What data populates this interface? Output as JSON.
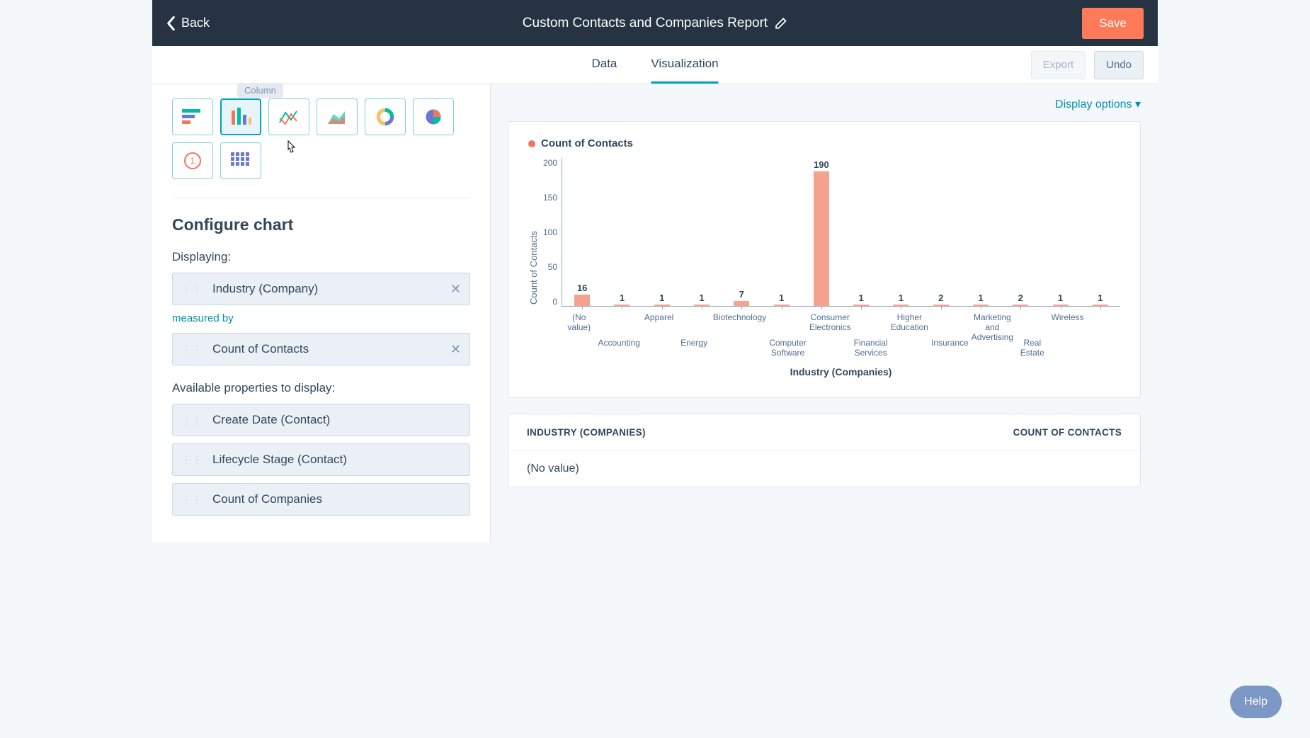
{
  "header": {
    "back_label": "Back",
    "title": "Custom Contacts and Companies Report",
    "save_label": "Save"
  },
  "tabs": {
    "data": "Data",
    "visualization": "Visualization",
    "export": "Export",
    "undo": "Undo"
  },
  "chart_types": {
    "tooltip": "Column",
    "items": [
      "bar-horizontal",
      "bar-vertical",
      "line",
      "area",
      "donut",
      "pie",
      "kpi",
      "table"
    ]
  },
  "sidebar": {
    "configure_heading": "Configure chart",
    "displaying_label": "Displaying:",
    "displaying_chip": "Industry (Company)",
    "measured_by_label": "measured by",
    "measured_by_chip": "Count of Contacts",
    "available_label": "Available properties to display:",
    "available": [
      "Create Date (Contact)",
      "Lifecycle Stage (Contact)",
      "Count of Companies"
    ]
  },
  "display_options": "Display options",
  "chart_data": {
    "type": "bar",
    "title": "",
    "legend": "Count of Contacts",
    "ylabel": "Count of Contacts",
    "xlabel": "Industry (Companies)",
    "ylim": [
      0,
      200
    ],
    "yticks": [
      200,
      150,
      100,
      50,
      0
    ],
    "categories": [
      "(No value)",
      "Accounting",
      "Apparel",
      "Energy",
      "Biotechnology",
      "Computer Software",
      "Consumer Electronics",
      "Financial Services",
      "Higher Education",
      "Insurance",
      "Marketing and Advertising",
      "Real Estate",
      "Wireless"
    ],
    "values": [
      16,
      1,
      1,
      1,
      7,
      1,
      190,
      1,
      1,
      2,
      1,
      2,
      1,
      1
    ]
  },
  "table": {
    "col1": "INDUSTRY (COMPANIES)",
    "col2": "COUNT OF CONTACTS",
    "rows": [
      "(No value)"
    ]
  },
  "help": "Help"
}
